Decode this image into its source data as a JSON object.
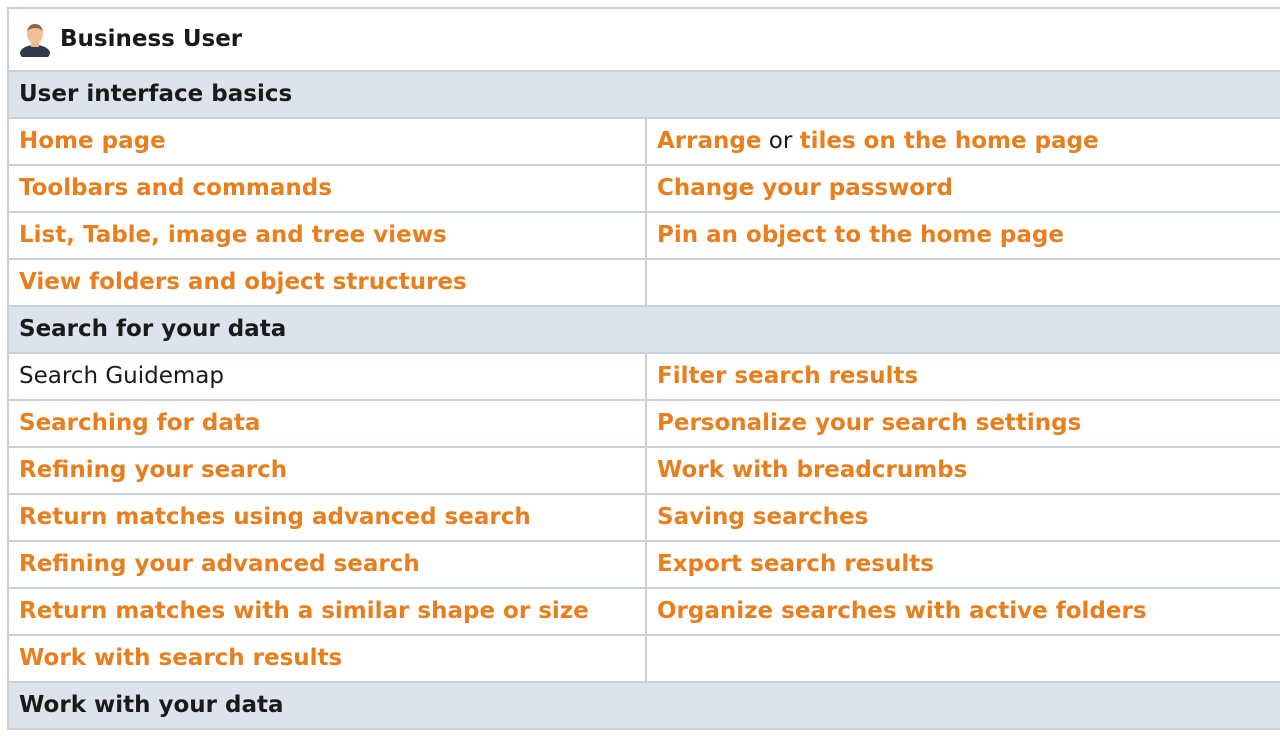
{
  "title": "Business User",
  "sections": [
    {
      "heading": "User interface basics",
      "rows": [
        {
          "left": "Home page",
          "right_parts": [
            "Arrange",
            " or ",
            "tiles on the home page"
          ]
        },
        {
          "left": "Toolbars and commands",
          "right": "Change your password"
        },
        {
          "left": "List, Table, image and tree views",
          "right": "Pin an object to the home page"
        },
        {
          "left": "View folders and object structures",
          "right": ""
        }
      ]
    },
    {
      "heading": "Search for your data",
      "rows": [
        {
          "left": "Search Guidemap",
          "right": "Filter search results"
        },
        {
          "left": "Searching for data",
          "right": "Personalize your search settings"
        },
        {
          "left": "Refining your search",
          "right": "Work with breadcrumbs"
        },
        {
          "left": "Return matches using advanced search",
          "right": "Saving searches"
        },
        {
          "left": "Refining your advanced search",
          "right": "Export search results"
        },
        {
          "left": "Return matches with a similar shape or size",
          "right": "Organize searches with active folders"
        },
        {
          "left": "Work with search results",
          "right": ""
        }
      ]
    },
    {
      "heading": "Work with your data"
    }
  ],
  "colors": {
    "link": "#e87f1e",
    "section_bg": "#dde3ec",
    "border": "#c8d0dc"
  },
  "icons": {
    "title": "user-avatar-icon"
  }
}
